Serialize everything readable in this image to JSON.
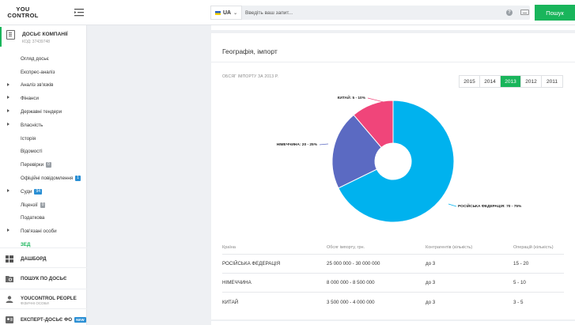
{
  "header": {
    "logo_line1": "YOU",
    "logo_line2": "CONTROL",
    "lang": "UA",
    "search_placeholder": "Введіть ваш запит...",
    "help_icon": "?",
    "search_button": "Пошук"
  },
  "sidebar": {
    "company_title": "ДОСЬЄ КОМПАНІЇ",
    "company_code": "КОД: 37439748",
    "items": [
      {
        "label": "Огляд досьє",
        "arrow": false
      },
      {
        "label": "Експрес-аналіз",
        "arrow": false
      },
      {
        "label": "Аналіз зв'язків",
        "arrow": true
      },
      {
        "label": "Фінанси",
        "arrow": true
      },
      {
        "label": "Державні тендери",
        "arrow": true
      },
      {
        "label": "Власність",
        "arrow": true
      },
      {
        "label": "Історія",
        "arrow": false
      },
      {
        "label": "Відомості",
        "arrow": false
      },
      {
        "label": "Перевірки",
        "arrow": false,
        "badge": "0"
      },
      {
        "label": "Офіційні повідомлення",
        "arrow": false,
        "badge": "1"
      },
      {
        "label": "Суди",
        "arrow": true,
        "badge": "94"
      },
      {
        "label": "Ліцензії",
        "arrow": false,
        "badge": "0"
      },
      {
        "label": "Податкова",
        "arrow": false
      },
      {
        "label": "Пов'язані особи",
        "arrow": true
      },
      {
        "label": "ЗЕД",
        "arrow": false
      }
    ],
    "dashboard": "ДАШБОРД",
    "search_dossier": "ПОШУК ПО ДОСЬЄ",
    "people_title": "YOUCONTROL PEOPLE",
    "people_sub": "ФІЗИЧНІ ОСОБИ",
    "expert": "ЕКСПЕРТ-ДОСЬЄ ФО",
    "expert_badge": "NEW"
  },
  "main": {
    "title": "Географія, імпорт",
    "chart_label": "ОБСЯГ ІМПОРТУ ЗА 2013 Р.",
    "years": [
      "2015",
      "2014",
      "2013",
      "2012",
      "2011"
    ],
    "active_year": "2013",
    "table": {
      "headers": [
        "Країна",
        "Обсяг імпорту, грн.",
        "Контрагентів (кількість)",
        "Операцій (кількість)"
      ],
      "rows": [
        [
          "РОСІЙСЬКА ФЕДЕРАЦІЯ",
          "25 000 000 - 30 000 000",
          "до 3",
          "15 - 20"
        ],
        [
          "НІМЕЧЧИНА",
          "8 000 000 - 8 500 000",
          "до 3",
          "5 - 10"
        ],
        [
          "КИТАЙ",
          "3 500 000 - 4 000 000",
          "до 3",
          "3 - 5"
        ]
      ]
    }
  },
  "chart_data": {
    "type": "pie",
    "donut": true,
    "slices": [
      {
        "label": "РОСІЙСЬКА ФЕДЕРАЦІЯ: 70 - 75%",
        "value": 72.5,
        "color": "#00b2ee"
      },
      {
        "label": "НІМЕЧЧИНА: 20 - 25%",
        "value": 22.5,
        "color": "#5b6ac2"
      },
      {
        "label": "КИТАЙ: 5 - 10%",
        "value": 12,
        "color": "#f0457a"
      }
    ]
  }
}
